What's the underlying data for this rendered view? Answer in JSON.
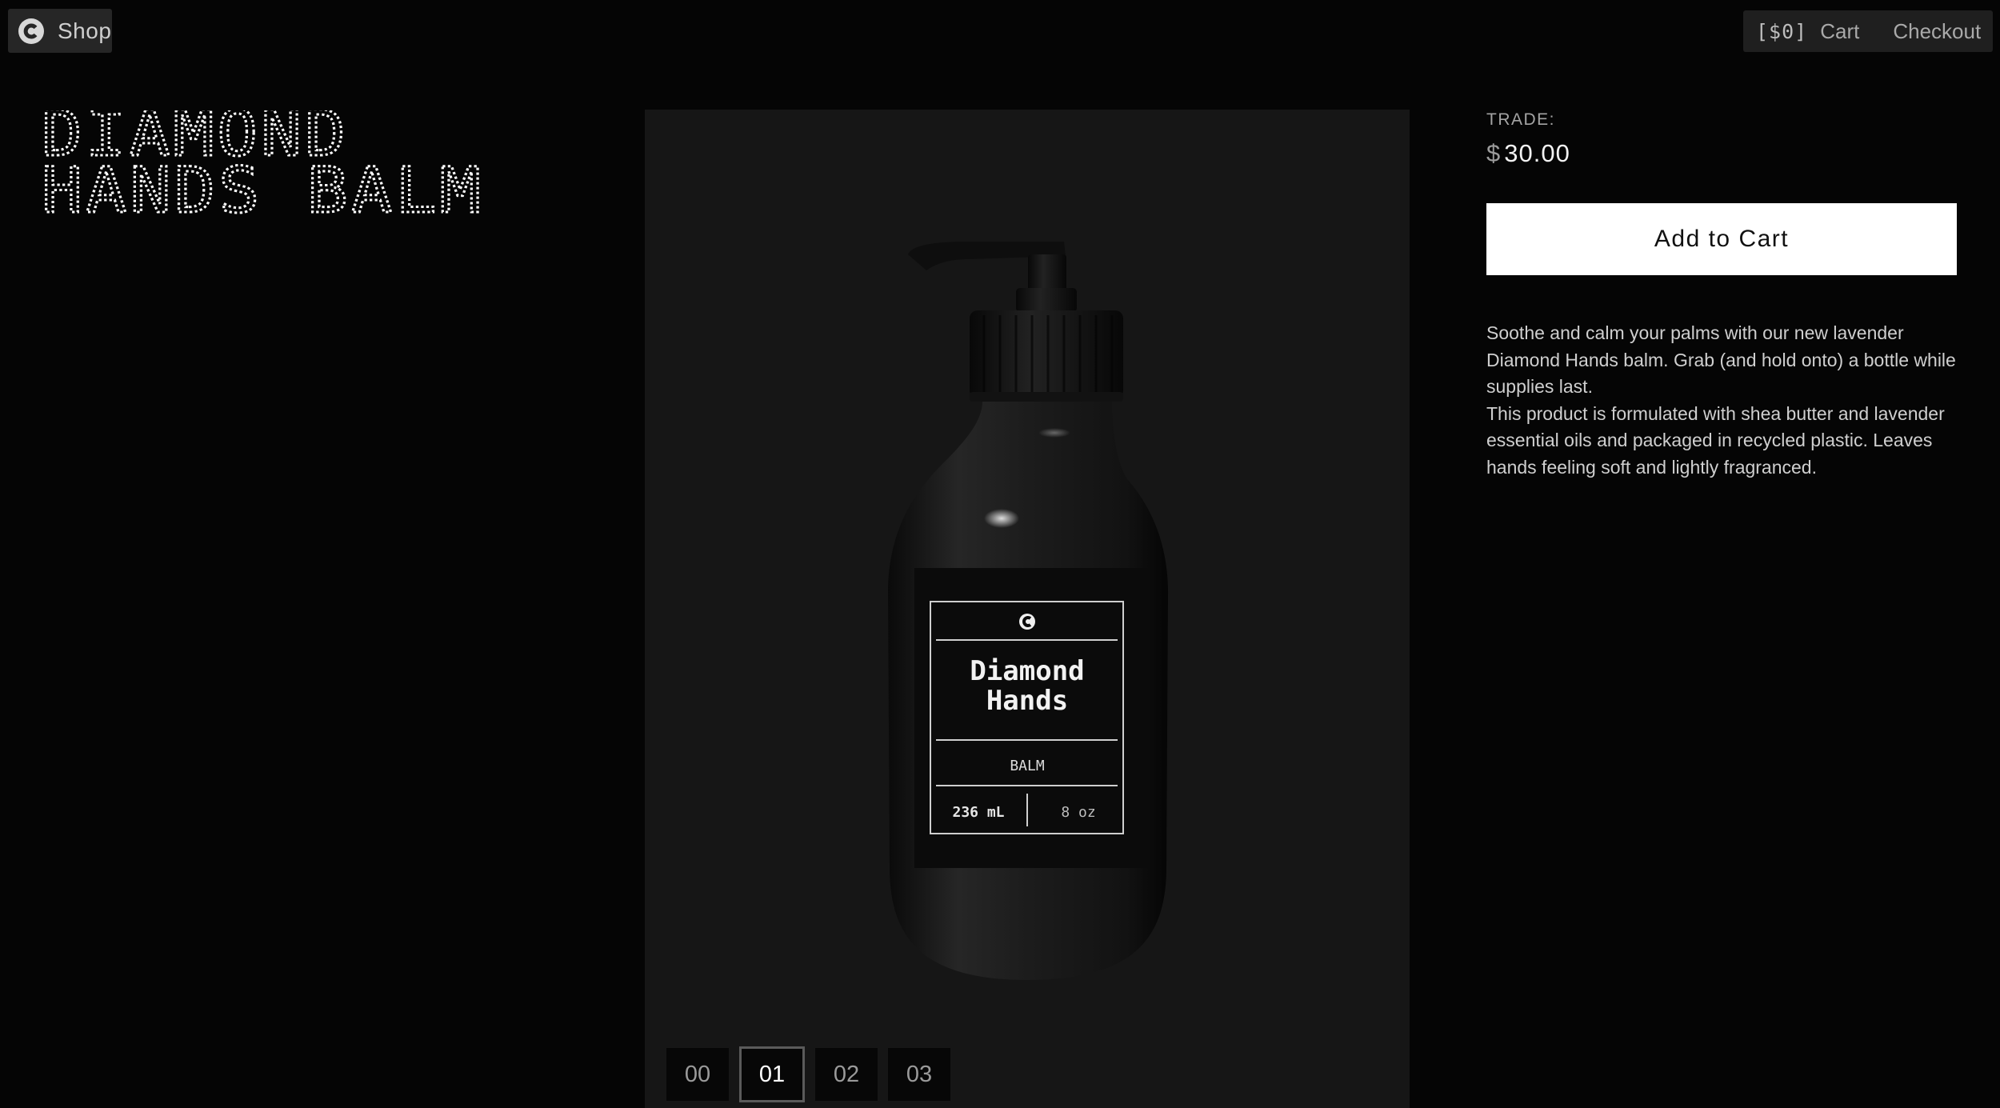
{
  "header": {
    "shop_label": "Shop",
    "cart_count": "[$0]",
    "cart_label": "Cart",
    "checkout_label": "Checkout"
  },
  "product": {
    "title_line1": "DIAMOND",
    "title_line2": "HANDS BALM",
    "price_label": "TRADE:",
    "currency_symbol": "$",
    "price": "30.00",
    "add_to_cart_label": "Add to Cart",
    "description": [
      "Soothe and calm your palms with our new lavender Diamond Hands balm. Grab (and hold onto) a bottle while supplies last.",
      "This product is formulated with shea butter and lavender essential oils and packaged in recycled plastic. Leaves hands feeling soft and lightly fragranced."
    ]
  },
  "bottle_label": {
    "name_line1": "Diamond",
    "name_line2": "Hands",
    "type": "BALM",
    "volume_ml": "236 mL",
    "volume_oz": "8 oz"
  },
  "gallery": {
    "thumbnails": [
      "00",
      "01",
      "02",
      "03"
    ],
    "active_index": 1
  },
  "colors": {
    "background": "#050505",
    "gallery_bg": "#161616",
    "button_bg": "#ffffff"
  },
  "icons": {
    "brand_logo": "c-logo-icon"
  }
}
